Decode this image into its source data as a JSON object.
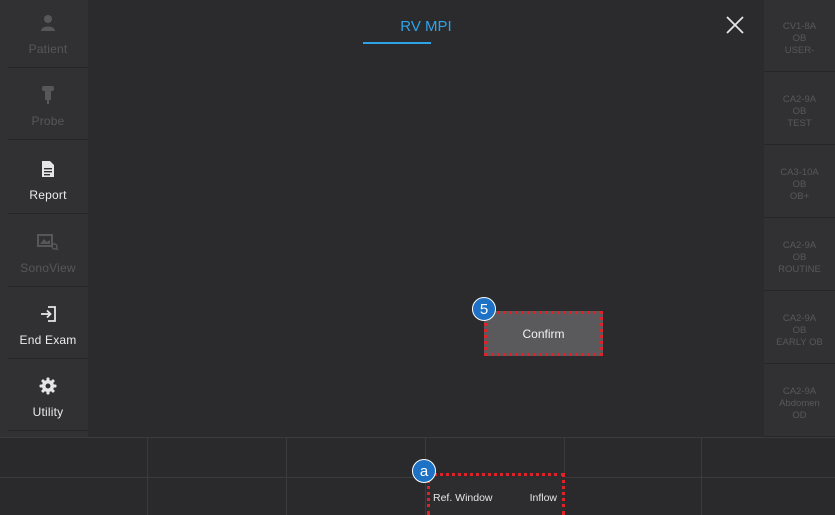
{
  "sidebar": {
    "items": [
      {
        "label": "Patient",
        "icon": "person-icon",
        "enabled": false
      },
      {
        "label": "Probe",
        "icon": "probe-icon",
        "enabled": false
      },
      {
        "label": "Report",
        "icon": "document-icon",
        "enabled": true
      },
      {
        "label": "SonoView",
        "icon": "image-search-icon",
        "enabled": false
      },
      {
        "label": "End Exam",
        "icon": "exit-icon",
        "enabled": true
      },
      {
        "label": "Utility",
        "icon": "gear-icon",
        "enabled": true
      }
    ]
  },
  "header": {
    "title": "RV MPI"
  },
  "dialog": {
    "confirm_label": "Confirm",
    "step_marker": "5"
  },
  "presets": [
    {
      "line1": "CV1-8A",
      "line2": "OB",
      "line3": "USER-"
    },
    {
      "line1": "CA2-9A",
      "line2": "OB",
      "line3": "TEST"
    },
    {
      "line1": "CA3-10A",
      "line2": "OB",
      "line3": "OB+"
    },
    {
      "line1": "CA2-9A",
      "line2": "OB",
      "line3": "ROUTINE"
    },
    {
      "line1": "CA2-9A",
      "line2": "OB",
      "line3": "EARLY OB"
    },
    {
      "line1": "CA2-9A",
      "line2": "Abdomen",
      "line3": "OD"
    }
  ],
  "softkeys": {
    "marker": "a",
    "left_label": "Ref. Window",
    "right_label": "Inflow"
  },
  "colors": {
    "accent": "#2fa3e6",
    "highlight": "#e0232b",
    "marker": "#1d72c5",
    "background": "#2b2b2d"
  }
}
